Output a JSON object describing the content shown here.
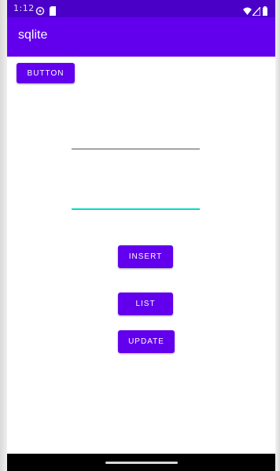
{
  "status_bar": {
    "time": "1:12",
    "icons": [
      "settings-icon",
      "sim-icon",
      "wifi-icon",
      "signal-icon",
      "battery-icon"
    ]
  },
  "app_bar": {
    "title": "sqlite"
  },
  "top_button": {
    "label": "BUTTON"
  },
  "fields": [
    {
      "value": "",
      "placeholder": ""
    },
    {
      "value": "",
      "placeholder": ""
    }
  ],
  "actions": {
    "insert_label": "INSERT",
    "list_label": "LIST",
    "update_label": "UPDATE"
  },
  "colors": {
    "primary": "#6200ee",
    "primary_dark": "#4b00c8",
    "accent": "#03dac5",
    "on_primary": "#ffffff"
  }
}
